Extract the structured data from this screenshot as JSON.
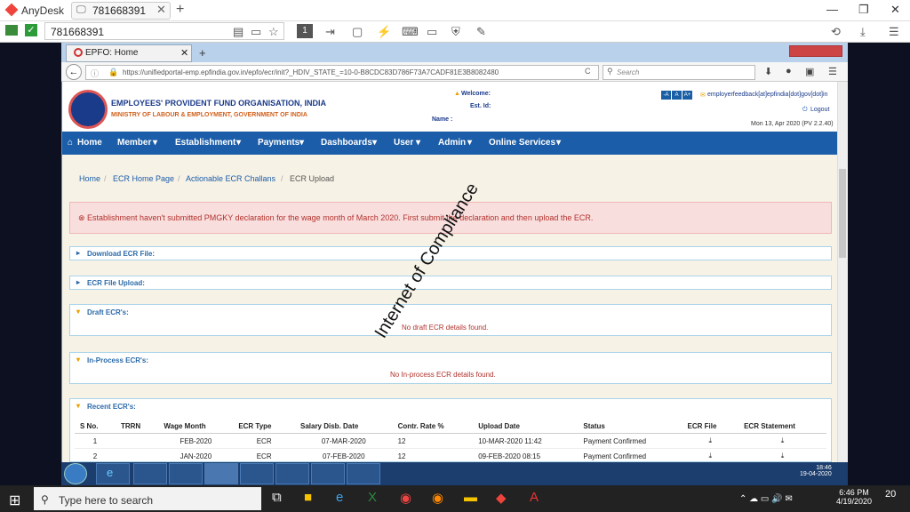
{
  "anydesk": {
    "app_name": "AnyDesk",
    "tab_label": "781668391",
    "address": "781668391",
    "button_num": "1"
  },
  "firefox": {
    "tab_label": "EPFO: Home",
    "url": "https://unifiedportal-emp.epfindia.gov.in/epfo/ecr/init?_HDIV_STATE_=10-0-B8CDC83D786F73A7CADF81E3B8082480",
    "search_placeholder": "Search"
  },
  "header": {
    "org_name": "EMPLOYEES' PROVIDENT FUND ORGANISATION, INDIA",
    "ministry": "MINISTRY OF LABOUR & EMPLOYMENT, GOVERNMENT OF INDIA",
    "welcome": "Welcome:",
    "est_id": "Est. Id:",
    "name": "Name :",
    "font_small": "-A",
    "font_normal": "A",
    "font_large": "A+",
    "feedback": "employerfeedback[at]epfindia[dot]gov[dot]in",
    "logout": "Logout",
    "date": "Mon 13, Apr 2020 (PV 2.2.40)"
  },
  "menu": [
    "Home",
    "Member",
    "Establishment",
    "Payments",
    "Dashboards",
    "User",
    "Admin",
    "Online Services"
  ],
  "breadcrumb": [
    "Home",
    "ECR Home Page",
    "Actionable ECR Challans",
    "ECR Upload"
  ],
  "alert": "Establishment haven't submitted PMGKY declaration for the wage month of March 2020. First submit the declaration and then upload the ECR.",
  "panels": {
    "download": "Download ECR File:",
    "upload": "ECR File Upload:",
    "draft": "Draft ECR's:",
    "draft_msg": "No draft ECR details found.",
    "inprocess": "In-Process ECR's:",
    "inprocess_msg": "No In-process ECR details found.",
    "recent": "Recent ECR's:"
  },
  "table": {
    "headers": [
      "S No.",
      "TRRN",
      "Wage Month",
      "ECR Type",
      "Salary Disb. Date",
      "Contr. Rate %",
      "Upload Date",
      "Status",
      "ECR File",
      "ECR Statement"
    ],
    "rows": [
      [
        "1",
        "",
        "FEB-2020",
        "ECR",
        "07-MAR-2020",
        "12",
        "10-MAR-2020 11:42",
        "Payment Confirmed"
      ],
      [
        "2",
        "",
        "JAN-2020",
        "ECR",
        "07-FEB-2020",
        "12",
        "09-FEB-2020 08:15",
        "Payment Confirmed"
      ]
    ]
  },
  "watermark": "Internet of Compliance",
  "remote_clock": {
    "time": "18:46",
    "date": "19-04-2020"
  },
  "local_taskbar": {
    "search_placeholder": "Type here to search",
    "time": "6:46 PM",
    "date": "4/19/2020",
    "notif": "20"
  }
}
